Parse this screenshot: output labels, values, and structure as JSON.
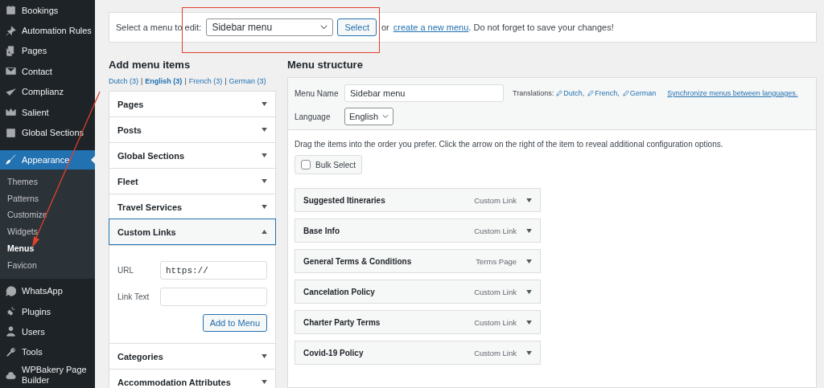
{
  "sidebar": {
    "items": [
      {
        "label": "Bookings",
        "selected": false
      },
      {
        "label": "Automation Rules",
        "selected": false
      },
      {
        "label": "Pages",
        "selected": false
      },
      {
        "label": "Contact",
        "selected": false
      },
      {
        "label": "Complianz",
        "selected": false
      },
      {
        "label": "Salient",
        "selected": false
      },
      {
        "label": "Global Sections",
        "selected": false
      },
      {
        "label": "Appearance",
        "selected": true,
        "children": [
          {
            "label": "Themes",
            "selected": false
          },
          {
            "label": "Patterns",
            "selected": false
          },
          {
            "label": "Customize",
            "selected": false
          },
          {
            "label": "Widgets",
            "selected": false
          },
          {
            "label": "Menus",
            "selected": true
          },
          {
            "label": "Favicon",
            "selected": false
          }
        ]
      },
      {
        "label": "WhatsApp",
        "selected": false
      },
      {
        "label": "Plugins",
        "selected": false
      },
      {
        "label": "Users",
        "selected": false
      },
      {
        "label": "Tools",
        "selected": false
      },
      {
        "label": "WPBakery Page Builder",
        "selected": false
      }
    ]
  },
  "menu_select": {
    "label": "Select a menu to edit:",
    "value": "Sidebar menu",
    "button": "Select",
    "or_text": "or",
    "link": "create a new menu",
    "suffix": ". Do not forget to save your changes!"
  },
  "add_menu_items": {
    "title": "Add menu items",
    "language_separator": "|",
    "languages": [
      {
        "label": "Dutch (3)",
        "selected": false
      },
      {
        "label": "English (3)",
        "selected": true
      },
      {
        "label": "French (3)",
        "selected": false
      },
      {
        "label": "German (3)",
        "selected": false
      }
    ],
    "sections": [
      {
        "label": "Pages",
        "expanded": false
      },
      {
        "label": "Posts",
        "expanded": false
      },
      {
        "label": "Global Sections",
        "expanded": false
      },
      {
        "label": "Fleet",
        "expanded": false
      },
      {
        "label": "Travel Services",
        "expanded": false
      },
      {
        "label": "Custom Links",
        "expanded": true
      },
      {
        "label": "Categories",
        "expanded": false
      },
      {
        "label": "Accommodation Attributes",
        "expanded": false
      }
    ],
    "custom_links": {
      "url_label": "URL",
      "url_value": "https://",
      "link_text_label": "Link Text",
      "button": "Add to Menu"
    }
  },
  "menu_structure": {
    "title": "Menu structure",
    "menu_name_label": "Menu Name",
    "menu_name_value": "Sidebar menu",
    "translations_label": "Translations:",
    "translations": [
      "Dutch,",
      "French,",
      "German"
    ],
    "sync_link": "Synchronize menus between languages.",
    "language_label": "Language",
    "language_value": "English",
    "instructions": "Drag the items into the order you prefer. Click the arrow on the right of the item to reveal additional configuration options.",
    "bulk_select": {
      "label": "Bulk Select",
      "checked": false
    },
    "items": [
      {
        "title": "Suggested Itineraries",
        "type": "Custom Link"
      },
      {
        "title": "Base Info",
        "type": "Custom Link"
      },
      {
        "title": "General Terms & Conditions",
        "type": "Terms Page"
      },
      {
        "title": "Cancelation Policy",
        "type": "Custom Link"
      },
      {
        "title": "Charter Party Terms",
        "type": "Custom Link"
      },
      {
        "title": "Covid-19 Policy",
        "type": "Custom Link"
      }
    ]
  }
}
